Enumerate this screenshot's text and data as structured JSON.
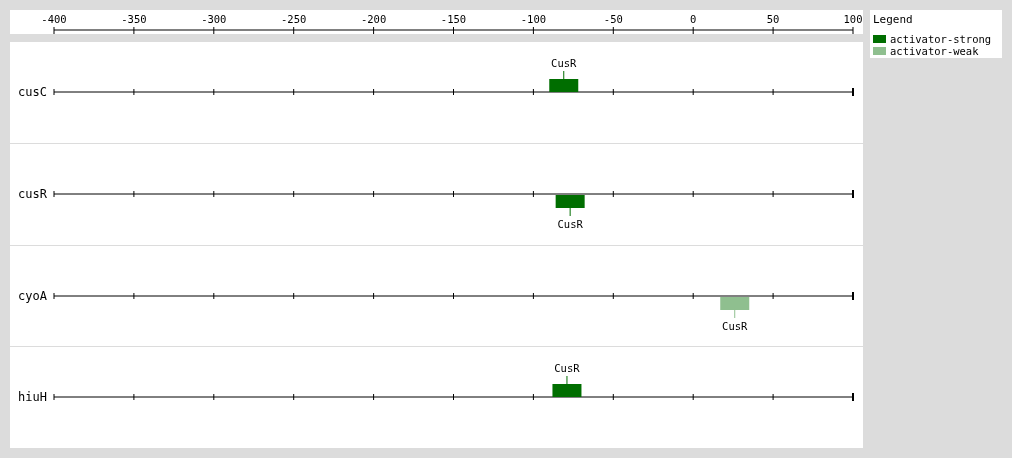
{
  "chart_data": {
    "type": "scatter",
    "orientation": "horizontal",
    "grid": true,
    "legend": true,
    "xlim": [
      -400,
      100
    ],
    "xticks": [
      -400,
      -350,
      -300,
      -250,
      -200,
      -150,
      -100,
      -50,
      0,
      50,
      100
    ],
    "categories": [
      "cusC",
      "cusR",
      "cyoA",
      "hiuH"
    ],
    "series": [
      {
        "name": "activator-strong",
        "color": "#006e00",
        "values": [
          -81,
          -77,
          null,
          -79
        ]
      },
      {
        "name": "activator-weak",
        "color": "#8fbf8f",
        "values": [
          null,
          null,
          26,
          null
        ]
      }
    ]
  },
  "legend": {
    "title": "Legend"
  },
  "tracks": [
    {
      "sites": [
        {
          "label": "CusR",
          "kind": "above"
        }
      ]
    },
    {
      "sites": [
        {
          "label": "CusR",
          "kind": "below"
        }
      ]
    },
    {
      "sites": [
        {
          "label": "CusR",
          "kind": "below"
        }
      ]
    },
    {
      "sites": [
        {
          "label": "CusR",
          "kind": "above"
        }
      ]
    }
  ]
}
